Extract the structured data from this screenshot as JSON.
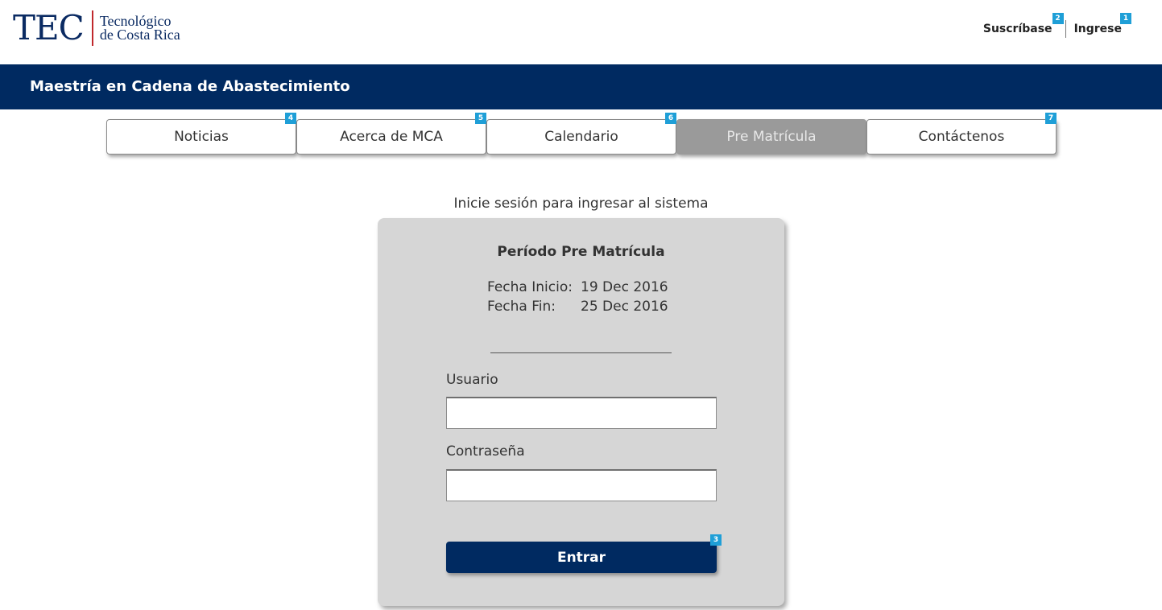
{
  "logo": {
    "acronym": "TEC",
    "line1": "Tecnológico",
    "line2": "de Costa Rica"
  },
  "top_nav": {
    "subscribe_label": "Suscríbase",
    "subscribe_badge": "2",
    "login_label": "Ingrese",
    "login_badge": "1"
  },
  "banner": {
    "title": "Maestría en Cadena de Abastecimiento"
  },
  "tabs": [
    {
      "label": "Noticias",
      "badge": "4",
      "active": false
    },
    {
      "label": "Acerca de MCA",
      "badge": "5",
      "active": false
    },
    {
      "label": "Calendario",
      "badge": "6",
      "active": false
    },
    {
      "label": "Pre Matrícula",
      "badge": "",
      "active": true
    },
    {
      "label": "Contáctenos",
      "badge": "7",
      "active": false
    }
  ],
  "login": {
    "intro": "Inicie sesión para ingresar al sistema",
    "period_title": "Período Pre Matrícula",
    "start_label": "Fecha Inicio:",
    "start_value": "19 Dec 2016",
    "end_label": "Fecha Fin:",
    "end_value": "25 Dec 2016",
    "username_label": "Usuario",
    "username_value": "",
    "password_label": "Contraseña",
    "password_value": "",
    "submit_label": "Entrar",
    "submit_badge": "3"
  },
  "colors": {
    "brand_navy": "#002a61",
    "badge_blue": "#1f9fd7",
    "active_tab": "#9a9a9a",
    "card_bg": "#d6d6d6",
    "logo_divider": "#c0282c"
  }
}
